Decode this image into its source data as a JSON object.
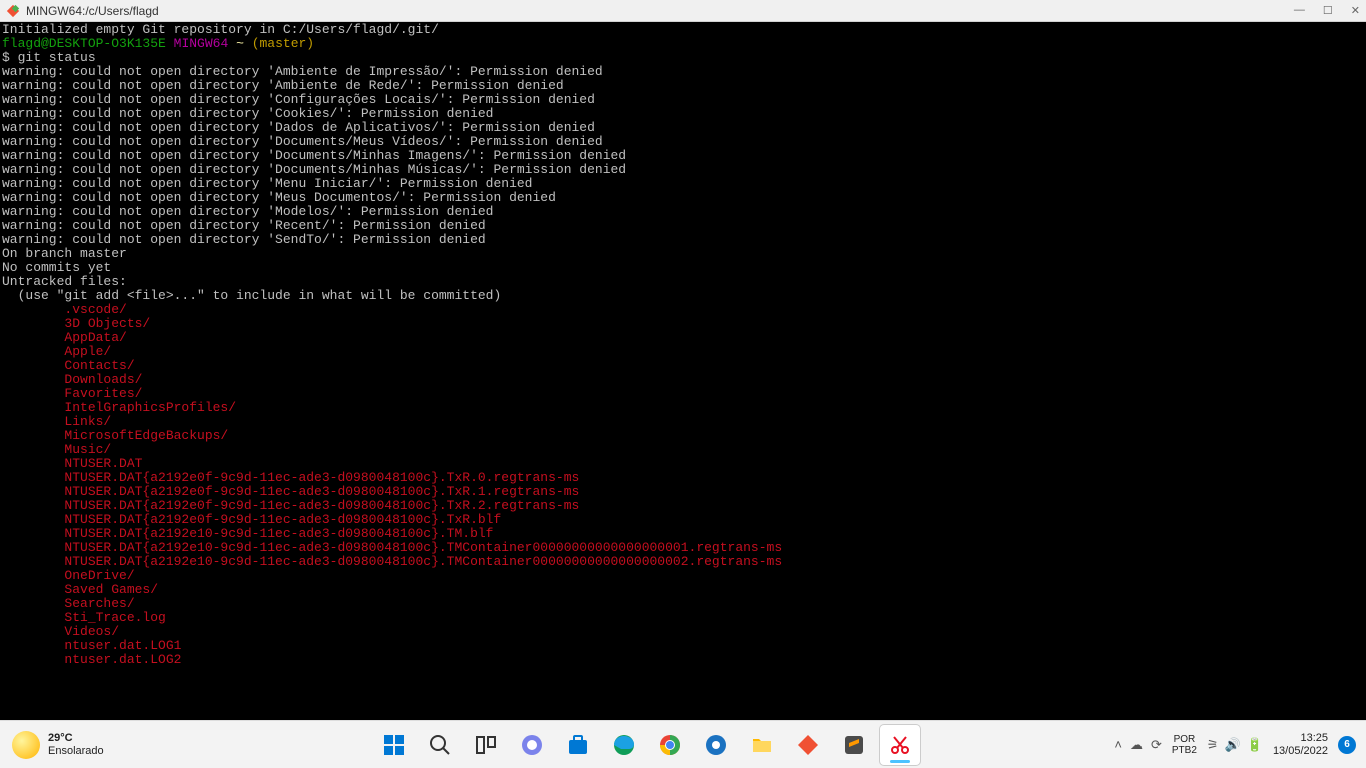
{
  "window": {
    "title": "MINGW64:/c/Users/flagd"
  },
  "terminal": {
    "init_line": "Initialized empty Git repository in C:/Users/flagd/.git/",
    "prompt_user": "flagd@DESKTOP-O3K135E",
    "prompt_env": "MINGW64",
    "prompt_path": "~",
    "prompt_branch": "(master)",
    "command": "$ git status",
    "warnings": [
      "warning: could not open directory 'Ambiente de Impressão/': Permission denied",
      "warning: could not open directory 'Ambiente de Rede/': Permission denied",
      "warning: could not open directory 'Configurações Locais/': Permission denied",
      "warning: could not open directory 'Cookies/': Permission denied",
      "warning: could not open directory 'Dados de Aplicativos/': Permission denied",
      "warning: could not open directory 'Documents/Meus Vídeos/': Permission denied",
      "warning: could not open directory 'Documents/Minhas Imagens/': Permission denied",
      "warning: could not open directory 'Documents/Minhas Músicas/': Permission denied",
      "warning: could not open directory 'Menu Iniciar/': Permission denied",
      "warning: could not open directory 'Meus Documentos/': Permission denied",
      "warning: could not open directory 'Modelos/': Permission denied",
      "warning: could not open directory 'Recent/': Permission denied",
      "warning: could not open directory 'SendTo/': Permission denied"
    ],
    "branch_line": "On branch master",
    "no_commits": "No commits yet",
    "untracked_header": "Untracked files:",
    "untracked_hint": "  (use \"git add <file>...\" to include in what will be committed)",
    "untracked": [
      ".vscode/",
      "3D Objects/",
      "AppData/",
      "Apple/",
      "Contacts/",
      "Downloads/",
      "Favorites/",
      "IntelGraphicsProfiles/",
      "Links/",
      "MicrosoftEdgeBackups/",
      "Music/",
      "NTUSER.DAT",
      "NTUSER.DAT{a2192e0f-9c9d-11ec-ade3-d0980048100c}.TxR.0.regtrans-ms",
      "NTUSER.DAT{a2192e0f-9c9d-11ec-ade3-d0980048100c}.TxR.1.regtrans-ms",
      "NTUSER.DAT{a2192e0f-9c9d-11ec-ade3-d0980048100c}.TxR.2.regtrans-ms",
      "NTUSER.DAT{a2192e0f-9c9d-11ec-ade3-d0980048100c}.TxR.blf",
      "NTUSER.DAT{a2192e10-9c9d-11ec-ade3-d0980048100c}.TM.blf",
      "NTUSER.DAT{a2192e10-9c9d-11ec-ade3-d0980048100c}.TMContainer00000000000000000001.regtrans-ms",
      "NTUSER.DAT{a2192e10-9c9d-11ec-ade3-d0980048100c}.TMContainer00000000000000000002.regtrans-ms",
      "OneDrive/",
      "Saved Games/",
      "Searches/",
      "Sti_Trace.log",
      "Videos/",
      "ntuser.dat.LOG1",
      "ntuser.dat.LOG2"
    ]
  },
  "taskbar": {
    "weather_temp": "29°C",
    "weather_desc": "Ensolarado",
    "lang_top": "POR",
    "lang_bottom": "PTB2",
    "time": "13:25",
    "date": "13/05/2022",
    "notif": "6"
  }
}
